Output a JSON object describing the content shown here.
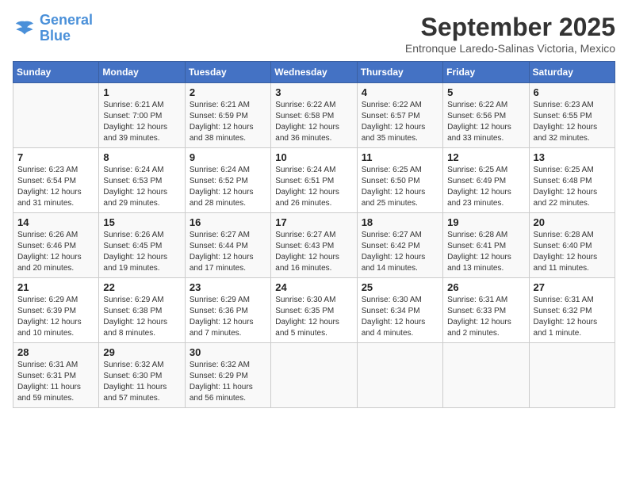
{
  "logo": {
    "line1": "General",
    "line2": "Blue"
  },
  "title": "September 2025",
  "location": "Entronque Laredo-Salinas Victoria, Mexico",
  "days_of_week": [
    "Sunday",
    "Monday",
    "Tuesday",
    "Wednesday",
    "Thursday",
    "Friday",
    "Saturday"
  ],
  "weeks": [
    [
      {
        "day": "",
        "info": ""
      },
      {
        "day": "1",
        "info": "Sunrise: 6:21 AM\nSunset: 7:00 PM\nDaylight: 12 hours\nand 39 minutes."
      },
      {
        "day": "2",
        "info": "Sunrise: 6:21 AM\nSunset: 6:59 PM\nDaylight: 12 hours\nand 38 minutes."
      },
      {
        "day": "3",
        "info": "Sunrise: 6:22 AM\nSunset: 6:58 PM\nDaylight: 12 hours\nand 36 minutes."
      },
      {
        "day": "4",
        "info": "Sunrise: 6:22 AM\nSunset: 6:57 PM\nDaylight: 12 hours\nand 35 minutes."
      },
      {
        "day": "5",
        "info": "Sunrise: 6:22 AM\nSunset: 6:56 PM\nDaylight: 12 hours\nand 33 minutes."
      },
      {
        "day": "6",
        "info": "Sunrise: 6:23 AM\nSunset: 6:55 PM\nDaylight: 12 hours\nand 32 minutes."
      }
    ],
    [
      {
        "day": "7",
        "info": "Sunrise: 6:23 AM\nSunset: 6:54 PM\nDaylight: 12 hours\nand 31 minutes."
      },
      {
        "day": "8",
        "info": "Sunrise: 6:24 AM\nSunset: 6:53 PM\nDaylight: 12 hours\nand 29 minutes."
      },
      {
        "day": "9",
        "info": "Sunrise: 6:24 AM\nSunset: 6:52 PM\nDaylight: 12 hours\nand 28 minutes."
      },
      {
        "day": "10",
        "info": "Sunrise: 6:24 AM\nSunset: 6:51 PM\nDaylight: 12 hours\nand 26 minutes."
      },
      {
        "day": "11",
        "info": "Sunrise: 6:25 AM\nSunset: 6:50 PM\nDaylight: 12 hours\nand 25 minutes."
      },
      {
        "day": "12",
        "info": "Sunrise: 6:25 AM\nSunset: 6:49 PM\nDaylight: 12 hours\nand 23 minutes."
      },
      {
        "day": "13",
        "info": "Sunrise: 6:25 AM\nSunset: 6:48 PM\nDaylight: 12 hours\nand 22 minutes."
      }
    ],
    [
      {
        "day": "14",
        "info": "Sunrise: 6:26 AM\nSunset: 6:46 PM\nDaylight: 12 hours\nand 20 minutes."
      },
      {
        "day": "15",
        "info": "Sunrise: 6:26 AM\nSunset: 6:45 PM\nDaylight: 12 hours\nand 19 minutes."
      },
      {
        "day": "16",
        "info": "Sunrise: 6:27 AM\nSunset: 6:44 PM\nDaylight: 12 hours\nand 17 minutes."
      },
      {
        "day": "17",
        "info": "Sunrise: 6:27 AM\nSunset: 6:43 PM\nDaylight: 12 hours\nand 16 minutes."
      },
      {
        "day": "18",
        "info": "Sunrise: 6:27 AM\nSunset: 6:42 PM\nDaylight: 12 hours\nand 14 minutes."
      },
      {
        "day": "19",
        "info": "Sunrise: 6:28 AM\nSunset: 6:41 PM\nDaylight: 12 hours\nand 13 minutes."
      },
      {
        "day": "20",
        "info": "Sunrise: 6:28 AM\nSunset: 6:40 PM\nDaylight: 12 hours\nand 11 minutes."
      }
    ],
    [
      {
        "day": "21",
        "info": "Sunrise: 6:29 AM\nSunset: 6:39 PM\nDaylight: 12 hours\nand 10 minutes."
      },
      {
        "day": "22",
        "info": "Sunrise: 6:29 AM\nSunset: 6:38 PM\nDaylight: 12 hours\nand 8 minutes."
      },
      {
        "day": "23",
        "info": "Sunrise: 6:29 AM\nSunset: 6:36 PM\nDaylight: 12 hours\nand 7 minutes."
      },
      {
        "day": "24",
        "info": "Sunrise: 6:30 AM\nSunset: 6:35 PM\nDaylight: 12 hours\nand 5 minutes."
      },
      {
        "day": "25",
        "info": "Sunrise: 6:30 AM\nSunset: 6:34 PM\nDaylight: 12 hours\nand 4 minutes."
      },
      {
        "day": "26",
        "info": "Sunrise: 6:31 AM\nSunset: 6:33 PM\nDaylight: 12 hours\nand 2 minutes."
      },
      {
        "day": "27",
        "info": "Sunrise: 6:31 AM\nSunset: 6:32 PM\nDaylight: 12 hours\nand 1 minute."
      }
    ],
    [
      {
        "day": "28",
        "info": "Sunrise: 6:31 AM\nSunset: 6:31 PM\nDaylight: 11 hours\nand 59 minutes."
      },
      {
        "day": "29",
        "info": "Sunrise: 6:32 AM\nSunset: 6:30 PM\nDaylight: 11 hours\nand 57 minutes."
      },
      {
        "day": "30",
        "info": "Sunrise: 6:32 AM\nSunset: 6:29 PM\nDaylight: 11 hours\nand 56 minutes."
      },
      {
        "day": "",
        "info": ""
      },
      {
        "day": "",
        "info": ""
      },
      {
        "day": "",
        "info": ""
      },
      {
        "day": "",
        "info": ""
      }
    ]
  ]
}
